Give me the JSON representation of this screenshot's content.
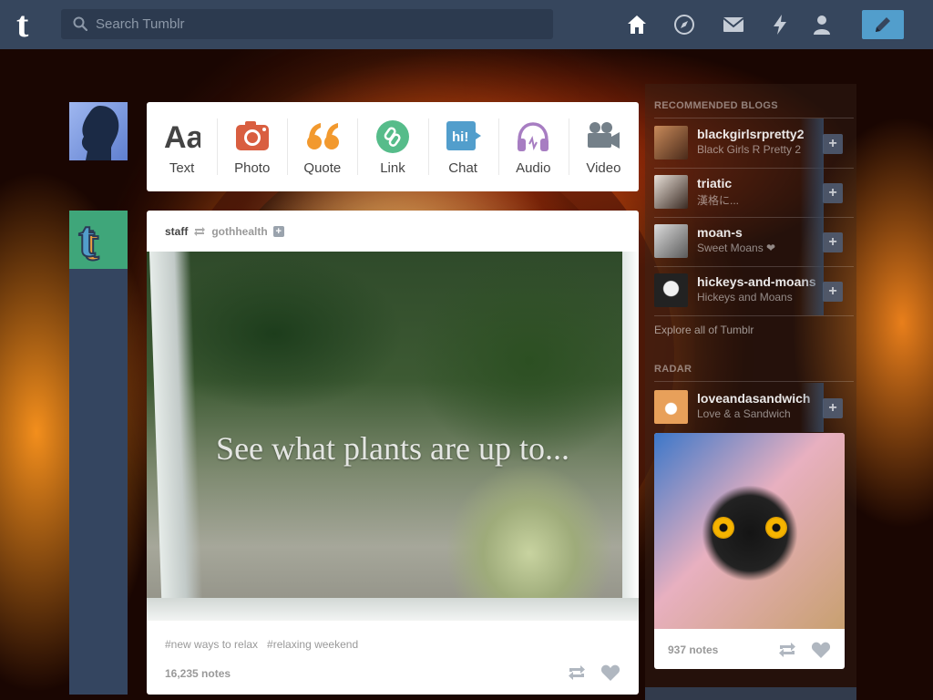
{
  "search": {
    "placeholder": "Search Tumblr"
  },
  "nav": {
    "icons": [
      "home-icon",
      "explore-icon",
      "inbox-icon",
      "activity-icon",
      "account-icon"
    ],
    "compose_icon": "pencil-icon",
    "brand_color": "#36465d",
    "compose_color": "#529ecc"
  },
  "post_types": [
    {
      "label": "Text",
      "icon": "text-icon",
      "color": "#444444"
    },
    {
      "label": "Photo",
      "icon": "camera-icon",
      "color": "#d95e40"
    },
    {
      "label": "Quote",
      "icon": "quote-icon",
      "color": "#f2992e"
    },
    {
      "label": "Link",
      "icon": "link-icon",
      "color": "#56bc8a"
    },
    {
      "label": "Chat",
      "icon": "chat-icon",
      "color": "#529ecc"
    },
    {
      "label": "Audio",
      "icon": "headphones-icon",
      "color": "#a77dc2"
    },
    {
      "label": "Video",
      "icon": "video-camera-icon",
      "color": "#748089"
    }
  ],
  "post": {
    "author": "staff",
    "reblogged_from": "gothhealth",
    "image_caption": "See what plants are up to...",
    "tags": [
      "#new ways to relax",
      "#relaxing weekend"
    ],
    "notes": "16,235 notes"
  },
  "sidebar": {
    "recommended_heading": "RECOMMENDED BLOGS",
    "blogs": [
      {
        "name": "blackgirlsrpretty2",
        "title": "Black Girls R Pretty 2"
      },
      {
        "name": "triatic",
        "title": "漢格に..."
      },
      {
        "name": "moan-s",
        "title": "Sweet Moans ❤"
      },
      {
        "name": "hickeys-and-moans",
        "title": "Hickeys and Moans"
      }
    ],
    "explore_link": "Explore all of Tumblr",
    "radar_heading": "RADAR",
    "radar_blog": {
      "name": "loveandasandwich",
      "title": "Love & a Sandwich"
    },
    "radar_notes": "937 notes"
  }
}
